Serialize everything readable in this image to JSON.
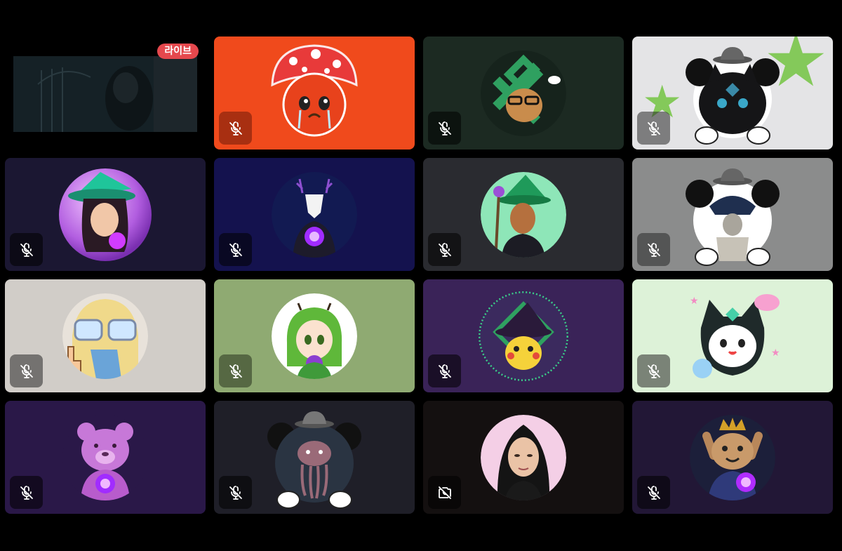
{
  "live_badge": "라이브",
  "icons": {
    "mic_muted": "mic-muted-icon",
    "camera_off": "camera-off-icon"
  },
  "participants": [
    {
      "bg": "#000000",
      "kind": "video",
      "status": "mic-muted"
    },
    {
      "bg": "#f04a1c",
      "kind": "tomato-mushroom-avatar",
      "status": "mic-muted"
    },
    {
      "bg": "#1c2a22",
      "kind": "cat-glasses-avatar",
      "status": "mic-muted"
    },
    {
      "bg": "#e4e4e6",
      "kind": "black-cat-fedora-avatar",
      "status": "mic-muted"
    },
    {
      "bg": "#1b1732",
      "kind": "witch-bubble-avatar",
      "status": "mic-muted"
    },
    {
      "bg": "#14124e",
      "kind": "deer-avatar",
      "status": "mic-muted"
    },
    {
      "bg": "#2a2b30",
      "kind": "wizard-avatar",
      "status": "mic-muted"
    },
    {
      "bg": "#8b8c8c",
      "kind": "scarecrow-fedora-avatar",
      "status": "mic-muted"
    },
    {
      "bg": "#d1cdc8",
      "kind": "glasses-girl-avatar",
      "status": "mic-muted"
    },
    {
      "bg": "#8faa72",
      "kind": "green-hair-girl-avatar",
      "status": "mic-muted"
    },
    {
      "bg": "#3a2358",
      "kind": "pikachu-witch-avatar",
      "status": "mic-muted"
    },
    {
      "bg": "#ddf2d8",
      "kind": "cat-hood-avatar",
      "status": "mic-muted"
    },
    {
      "bg": "#2a1848",
      "kind": "pink-bear-avatar",
      "status": "mic-muted"
    },
    {
      "bg": "#1f1f28",
      "kind": "jellyfish-fedora-avatar",
      "status": "mic-muted"
    },
    {
      "bg": "#141010",
      "kind": "person-photo-avatar",
      "status": "camera-off"
    },
    {
      "bg": "#221736",
      "kind": "crowned-dog-avatar",
      "status": "mic-muted"
    }
  ]
}
